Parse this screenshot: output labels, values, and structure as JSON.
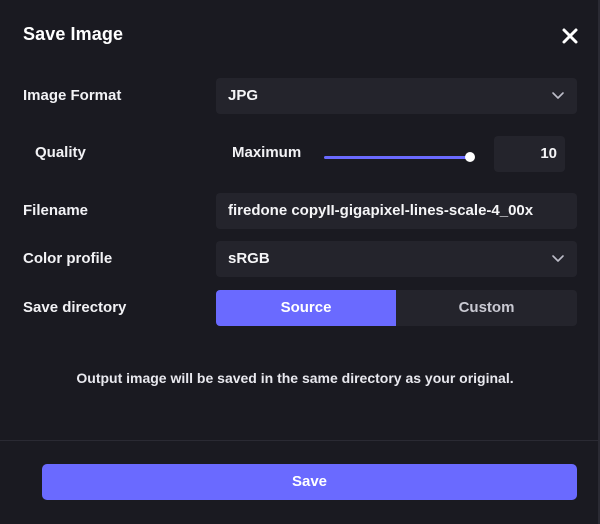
{
  "dialog": {
    "title": "Save Image",
    "close_icon": "close-icon"
  },
  "image_format": {
    "label": "Image Format",
    "value": "JPG"
  },
  "quality": {
    "label": "Quality",
    "level_label": "Maximum",
    "value": "10",
    "slider_fraction": 1.0
  },
  "filename": {
    "label": "Filename",
    "value": "firedone copyII-gigapixel-lines-scale-4_00x"
  },
  "color_profile": {
    "label": "Color profile",
    "value": "sRGB"
  },
  "save_directory": {
    "label": "Save directory",
    "options": [
      "Source",
      "Custom"
    ],
    "selected": "Source"
  },
  "info_text": "Output image will be saved in the same directory as your original.",
  "save_button": "Save",
  "colors": {
    "accent": "#6a6aff",
    "background": "#1a1a21",
    "field": "#24242c"
  }
}
